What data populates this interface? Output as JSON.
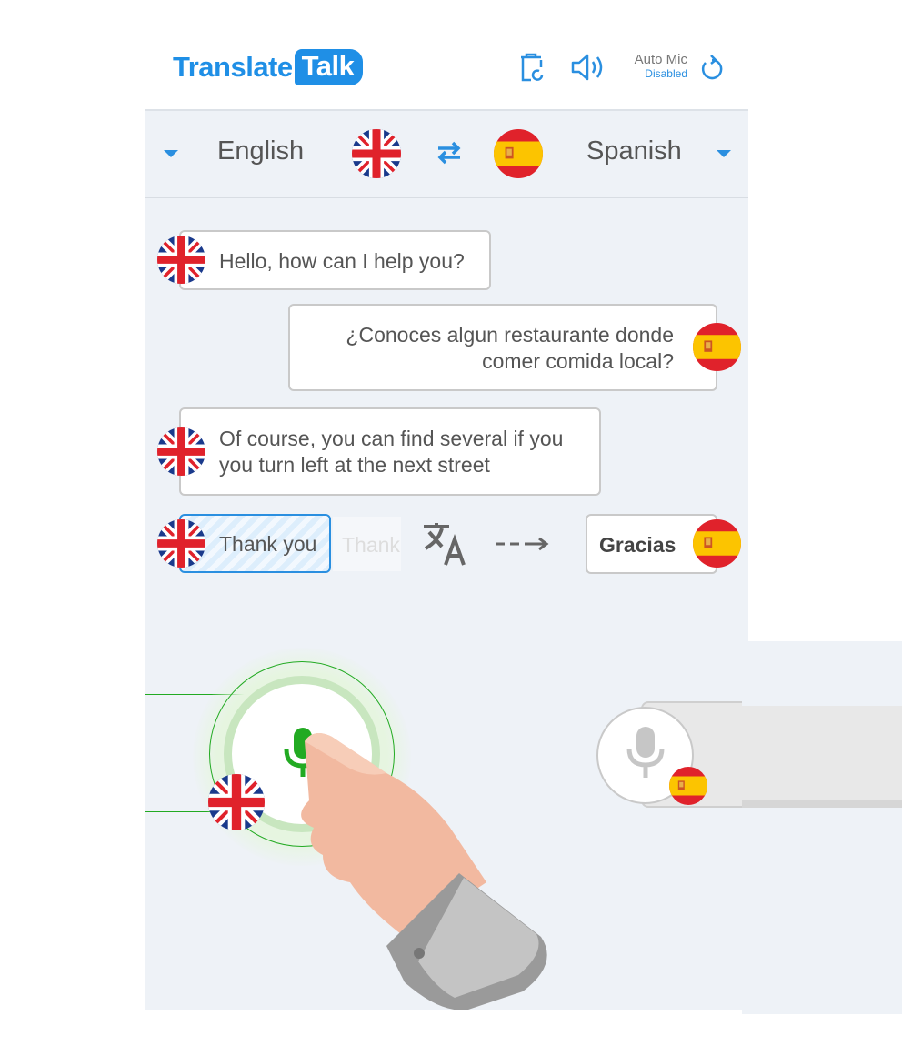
{
  "header": {
    "logo_part1": "Translate",
    "logo_part2": "Talk",
    "auto_mic_label": "Auto Mic",
    "auto_mic_status": "Disabled",
    "icons": [
      "clear-history-icon",
      "speaker-icon",
      "reset-icon"
    ]
  },
  "language_bar": {
    "source": "English",
    "target": "Spanish"
  },
  "messages": [
    {
      "lang": "en",
      "text": "Hello, how can I help you?"
    },
    {
      "lang": "es",
      "text_line1": "¿Conoces algun restaurante donde",
      "text_line2": "comer comida local?"
    },
    {
      "lang": "en",
      "text_line1": "Of course, you can find several if you",
      "text_line2": "you turn left at the next street"
    }
  ],
  "translation": {
    "input": "Thank you",
    "ghost": "Thank",
    "output": "Gracias"
  },
  "colors": {
    "accent": "#1f8fe6",
    "panel": "#eef2f7",
    "mic_green": "#22aa22"
  }
}
